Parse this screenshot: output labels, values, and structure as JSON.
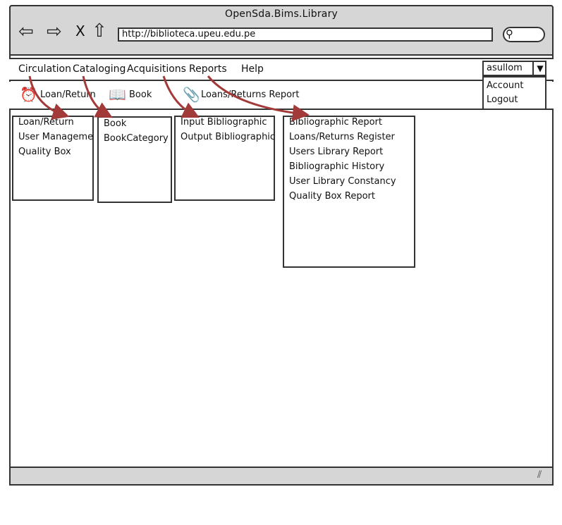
{
  "window": {
    "title": "OpenSda.Bims.Library"
  },
  "browser": {
    "back_icon": "back-arrow-icon",
    "forward_icon": "forward-arrow-icon",
    "stop_glyph": "X",
    "home_icon": "home-icon",
    "url": "http://biblioteca.upeu.edu.pe",
    "search_icon": "search-icon"
  },
  "menu": {
    "items": [
      "Circulation",
      "Cataloging",
      "Acquisitions",
      "Reports",
      "Help"
    ]
  },
  "user": {
    "selected": "asullom",
    "options": [
      "Account",
      "Logout"
    ]
  },
  "toolbar": {
    "items": [
      {
        "label": "Loan/Return",
        "icon": "alarm-clock-icon"
      },
      {
        "label": "Book",
        "icon": "open-book-icon"
      },
      {
        "label": "Loans/Returns Report",
        "icon": "paperclip-icon"
      }
    ]
  },
  "submenus": {
    "circulation": [
      "Loan/Return",
      "User Manageme",
      "Quality Box"
    ],
    "cataloging": [
      "Book",
      "BookCategory"
    ],
    "acquisitions": [
      "Input Bibliographic",
      "Output Bibliographic"
    ],
    "reports": [
      "Bibliographic Report",
      "Loans/Returns Register",
      "Users Library Report",
      "Bibliographic History",
      "User Library Constancy",
      "Quality Box Report"
    ]
  },
  "colors": {
    "arrow": "#a33a3a",
    "chrome": "#d6d6d6",
    "border": "#333333"
  }
}
